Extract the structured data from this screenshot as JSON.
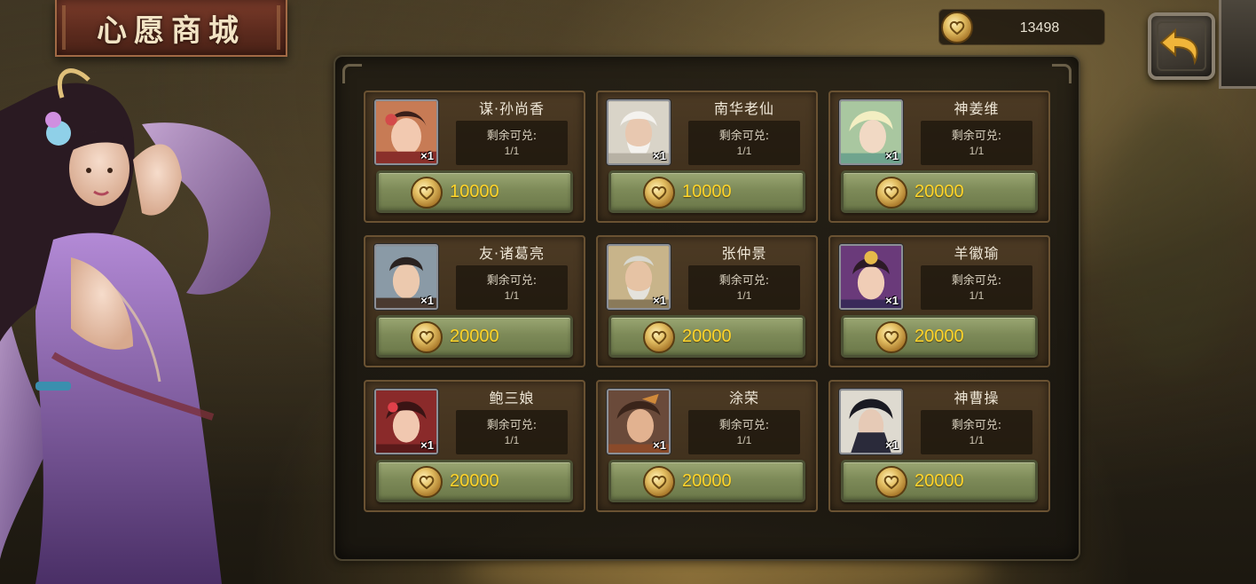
{
  "header": {
    "title": "心愿商城"
  },
  "currency": {
    "icon": "gold-coin-icon",
    "amount": "13498"
  },
  "back_button": {
    "icon": "back-arrow-icon"
  },
  "colors": {
    "price_text": "#ffd52a",
    "button_green": "#7d8a58",
    "card_bg": "#3a2c1a"
  },
  "shop": {
    "items": [
      {
        "name": "谋·孙尚香",
        "quantity": "×1",
        "stock_label": "剩余可兑:",
        "stock": "1/1",
        "price": "10000"
      },
      {
        "name": "南华老仙",
        "quantity": "×1",
        "stock_label": "剩余可兑:",
        "stock": "1/1",
        "price": "10000"
      },
      {
        "name": "神姜维",
        "quantity": "×1",
        "stock_label": "剩余可兑:",
        "stock": "1/1",
        "price": "20000"
      },
      {
        "name": "友·诸葛亮",
        "quantity": "×1",
        "stock_label": "剩余可兑:",
        "stock": "1/1",
        "price": "20000"
      },
      {
        "name": "张仲景",
        "quantity": "×1",
        "stock_label": "剩余可兑:",
        "stock": "1/1",
        "price": "20000"
      },
      {
        "name": "羊徽瑜",
        "quantity": "×1",
        "stock_label": "剩余可兑:",
        "stock": "1/1",
        "price": "20000"
      },
      {
        "name": "鲍三娘",
        "quantity": "×1",
        "stock_label": "剩余可兑:",
        "stock": "1/1",
        "price": "20000"
      },
      {
        "name": "涂荣",
        "quantity": "×1",
        "stock_label": "剩余可兑:",
        "stock": "1/1",
        "price": "20000"
      },
      {
        "name": "神曹操",
        "quantity": "×1",
        "stock_label": "剩余可兑:",
        "stock": "1/1",
        "price": "20000"
      }
    ]
  }
}
